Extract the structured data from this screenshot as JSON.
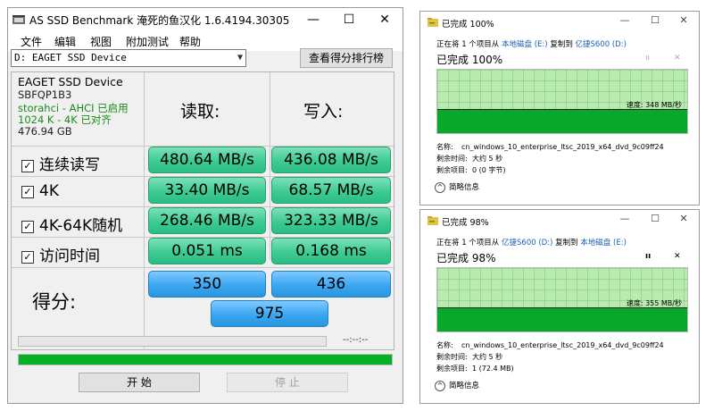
{
  "asssd": {
    "title": "AS SSD Benchmark 淹死的鱼汉化 1.6.4194.30305",
    "window_controls": {
      "minimize": "—",
      "maximize": "☐",
      "close": "✕"
    },
    "menu": [
      "文件",
      "编辑",
      "视图",
      "附加测试",
      "帮助"
    ],
    "drive_select": "D: EAGET SSD Device",
    "rank_button": "查看得分排行榜",
    "drive_info": [
      "EAGET SSD Device",
      "SBFQP1B3",
      "storahci - AHCI 已启用",
      "1024 K - 4K 已对齐",
      "476.94 GB"
    ],
    "read_header": "读取:",
    "write_header": "写入:",
    "rows": [
      {
        "label": "连续读写",
        "read": "480.64 MB/s",
        "write": "436.08 MB/s"
      },
      {
        "label": "4K",
        "read": "33.40 MB/s",
        "write": "68.57 MB/s"
      },
      {
        "label": "4K-64K随机",
        "read": "268.46 MB/s",
        "write": "323.33 MB/s"
      },
      {
        "label": "访问时间",
        "read": "0.051 ms",
        "write": "0.168 ms"
      }
    ],
    "checkbox_mark": "☑",
    "score_label": "得分:",
    "score_read": "350",
    "score_write": "436",
    "score_total": "975",
    "time_display": "--:--:--",
    "progress_fraction": 1.0,
    "start_button": "开 始",
    "stop_button": "停 止",
    "colors": {
      "result_green": "#3dcb93",
      "score_blue": "#3ca7f0",
      "progress_green": "#06b025"
    }
  },
  "dialogs": [
    {
      "title": "已完成 100%",
      "line1_prefix": "正在将 1 个项目从",
      "source": "本地磁盘 (E:)",
      "line1_mid": "复制到",
      "dest": "亿捷S600 (D:)",
      "progress_text": "已完成 100%",
      "speed": "速度: 348 MB/秒",
      "name_key": "名称:",
      "name_val": "cn_windows_10_enterprise_ltsc_2019_x64_dvd_9c09ff24",
      "time_key": "剩余时间:",
      "time_val": "大约 5 秒",
      "items_key": "剩余项目:",
      "items_val": "0 (0 字节)",
      "more": "简略信息",
      "controls": {
        "pause": "ıı",
        "stop": "✕"
      },
      "fraction": 1.0
    },
    {
      "title": "已完成 98%",
      "line1_prefix": "正在将 1 个项目从",
      "source": "亿捷S600 (D:)",
      "line1_mid": "复制到",
      "dest": "本地磁盘 (E:)",
      "progress_text": "已完成 98%",
      "speed": "速度: 355 MB/秒",
      "name_key": "名称:",
      "name_val": "cn_windows_10_enterprise_ltsc_2019_x64_dvd_9c09ff24",
      "time_key": "剩余时间:",
      "time_val": "大约 5 秒",
      "items_key": "剩余项目:",
      "items_val": "1 (72.4 MB)",
      "more": "简略信息",
      "controls": {
        "pause": "ıı",
        "stop": "✕"
      },
      "fraction": 0.98
    }
  ]
}
